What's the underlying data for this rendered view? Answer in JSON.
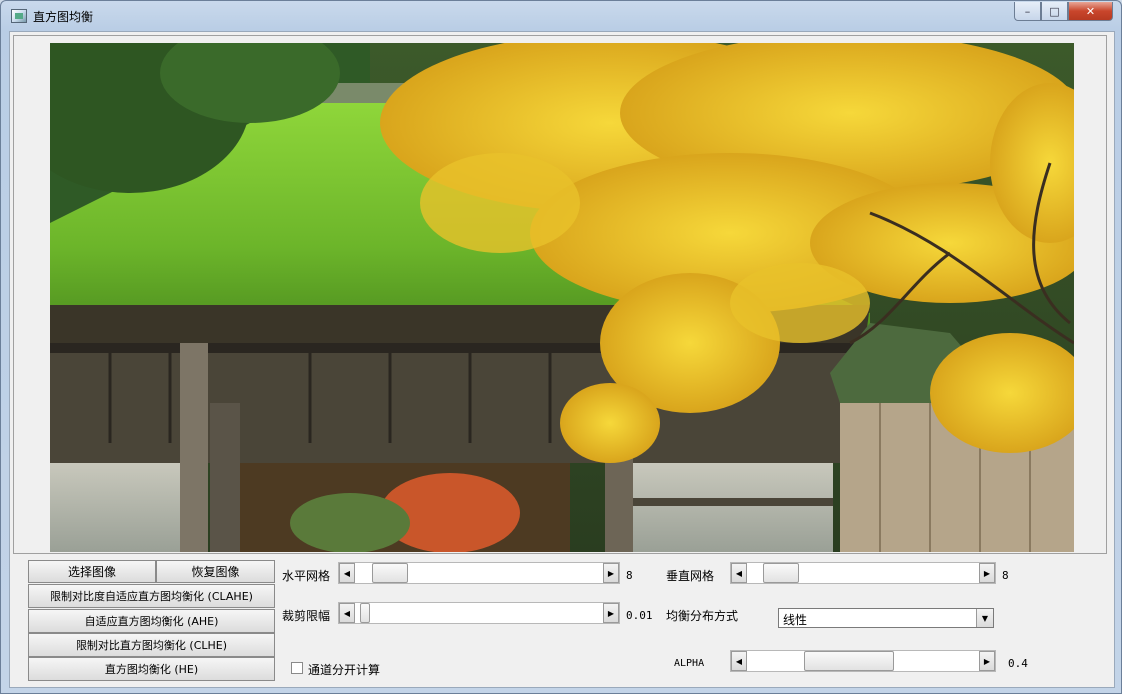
{
  "window": {
    "title": "直方图均衡",
    "minimize": "–",
    "maximize": "□",
    "close": "✕"
  },
  "buttons": {
    "select_image": "选择图像",
    "restore_image": "恢复图像",
    "clahe": "限制对比度自适应直方图均衡化 (CLAHE)",
    "ahe": "自适应直方图均衡化 (AHE)",
    "clhe": "限制对比直方图均衡化 (CLHE)",
    "he": "直方图均衡化 (HE)"
  },
  "controls": {
    "horizontal_grid": {
      "label": "水平网格",
      "value": "8",
      "level": 0.08
    },
    "vertical_grid": {
      "label": "垂直网格",
      "value": "8",
      "level": 0.08
    },
    "clip_limit": {
      "label": "裁剪限幅",
      "value": "0.01",
      "level": 0.02
    },
    "distribution": {
      "label": "均衡分布方式",
      "selected": "线性"
    },
    "alpha": {
      "label": "ALPHA",
      "value": "0.4",
      "level": 0.4
    },
    "separate_channels": {
      "label": "通道分开计算",
      "checked": false
    }
  },
  "icons": {
    "arrow_left": "◀",
    "arrow_right": "▶",
    "dropdown": "▼"
  }
}
